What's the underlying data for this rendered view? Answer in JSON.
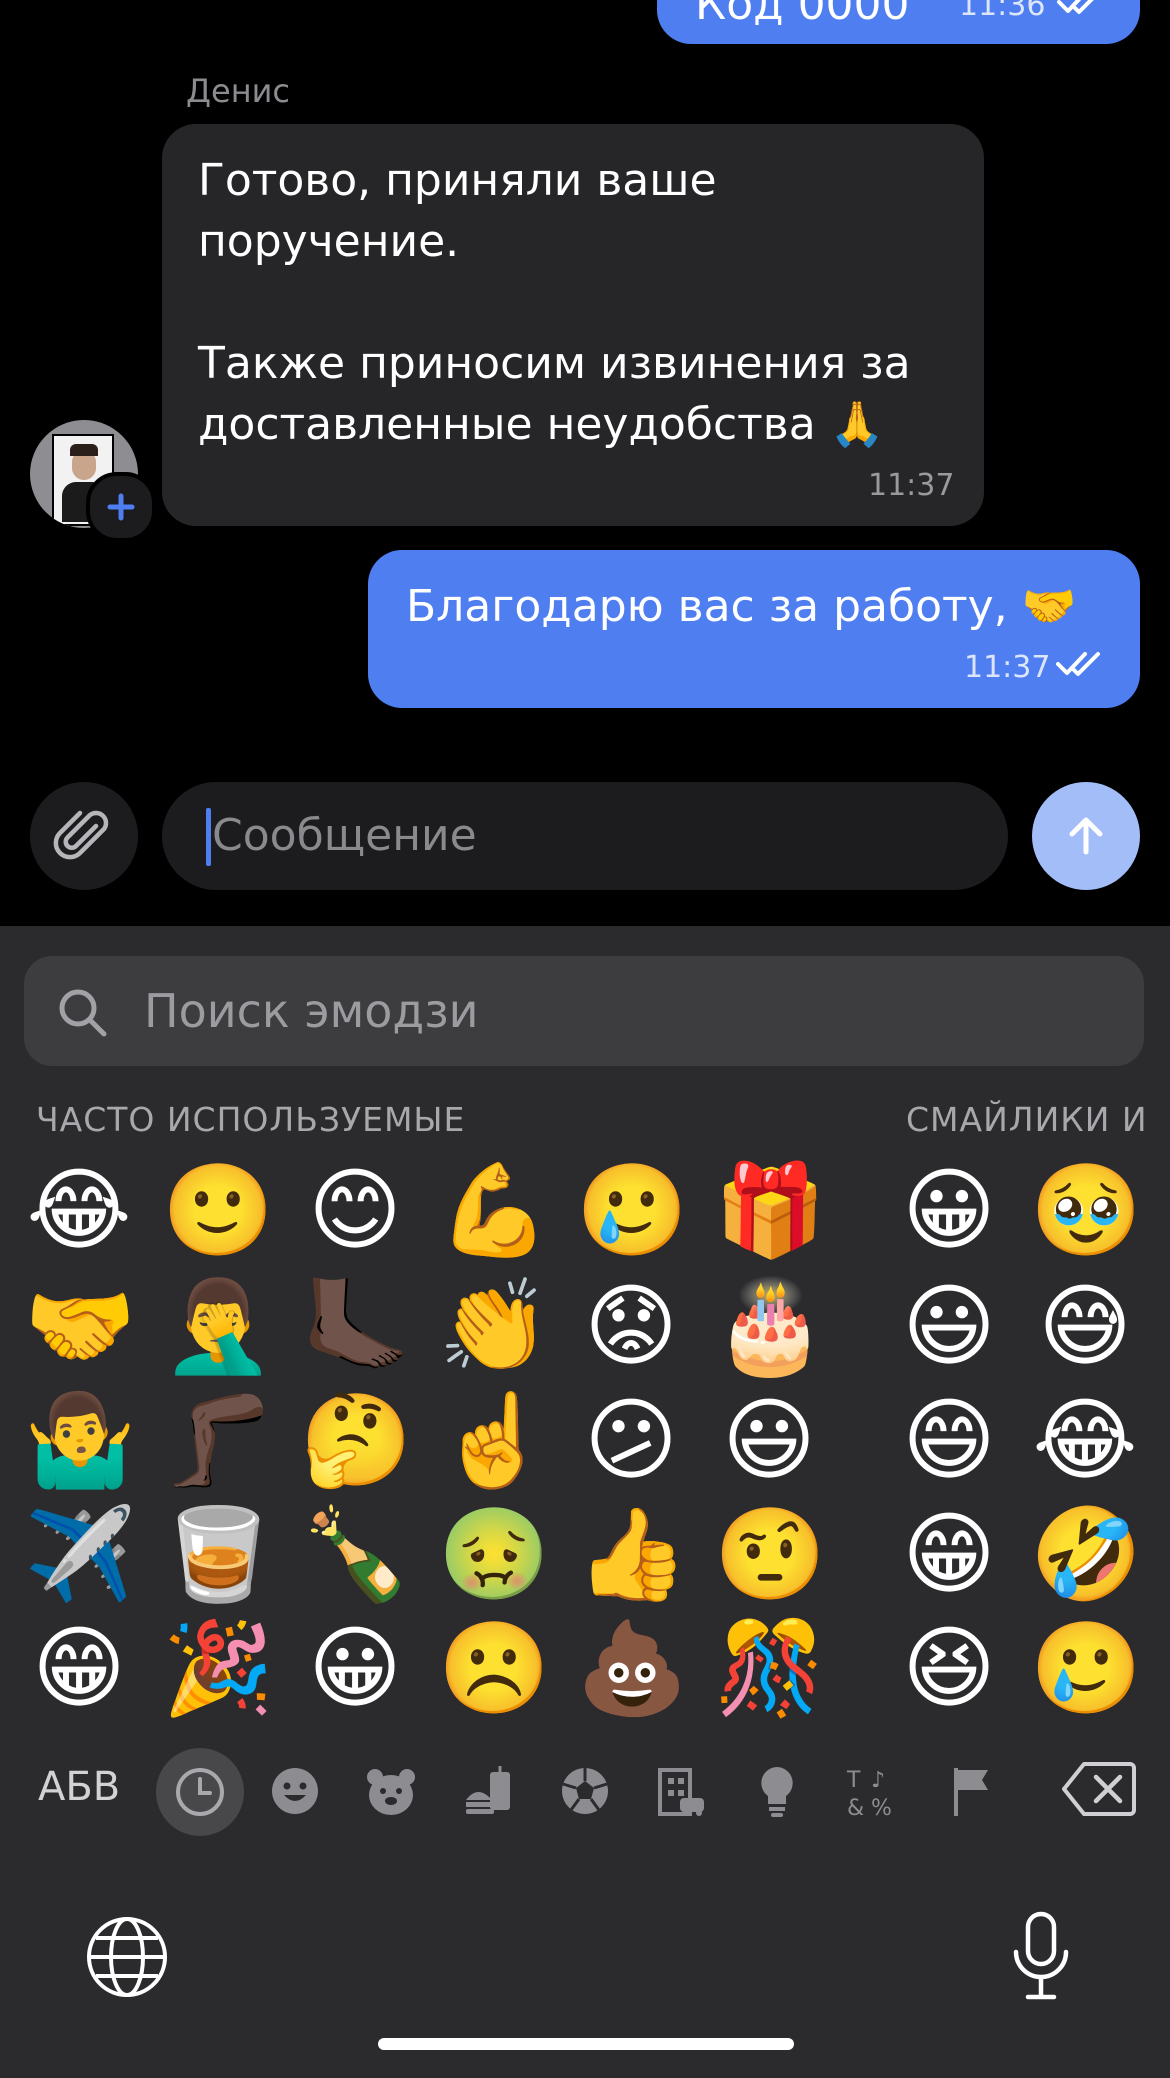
{
  "chat": {
    "top_partial_message": {
      "text": "Код 0000",
      "time": "11:36"
    },
    "incoming": {
      "sender": "Денис",
      "lines": [
        "Готово, приняли ваше",
        "поручение.",
        "",
        "Также приносим извинения за",
        "доставленные неудобства 🙏"
      ],
      "time": "11:37"
    },
    "outgoing": {
      "text": "Благодарю вас за работу, 🤝",
      "time": "11:37"
    }
  },
  "composer": {
    "placeholder": "Сообщение"
  },
  "emoji_keyboard": {
    "search_placeholder": "Поиск эмодзи",
    "sections": [
      "ЧАСТО ИСПОЛЬЗУЕМЫЕ",
      "СМАЙЛИКИ И"
    ],
    "frequent": [
      [
        "😂",
        "🙂",
        "😊",
        "💪",
        "🥲",
        "🎁"
      ],
      [
        "🤝",
        "🤦‍♂️",
        "🦶🏿",
        "👏",
        "😟",
        "🎂"
      ],
      [
        "🤷‍♂️",
        "🦵🏿",
        "🤔",
        "☝️",
        "😕",
        "😃"
      ],
      [
        "✈️",
        "🥃",
        "🍾",
        "🤢",
        "👍",
        "🤨"
      ],
      [
        "😁",
        "🎉",
        "😀",
        "☹️",
        "💩",
        "🎊"
      ]
    ],
    "smileys": [
      [
        "😀",
        "🥹"
      ],
      [
        "😃",
        "😅"
      ],
      [
        "😄",
        "😂"
      ],
      [
        "😁",
        "🤣"
      ],
      [
        "😆",
        "🥲"
      ]
    ],
    "abc_label": "АБВ",
    "categories": [
      "recent-clock-icon",
      "smiley-icon",
      "bear-icon",
      "food-icon",
      "ball-icon",
      "building-icon",
      "bulb-icon",
      "symbols-icon",
      "flag-icon"
    ],
    "colors": {
      "accent": "#4e7ef0",
      "keyboard_bg": "#2b2b2d"
    }
  }
}
